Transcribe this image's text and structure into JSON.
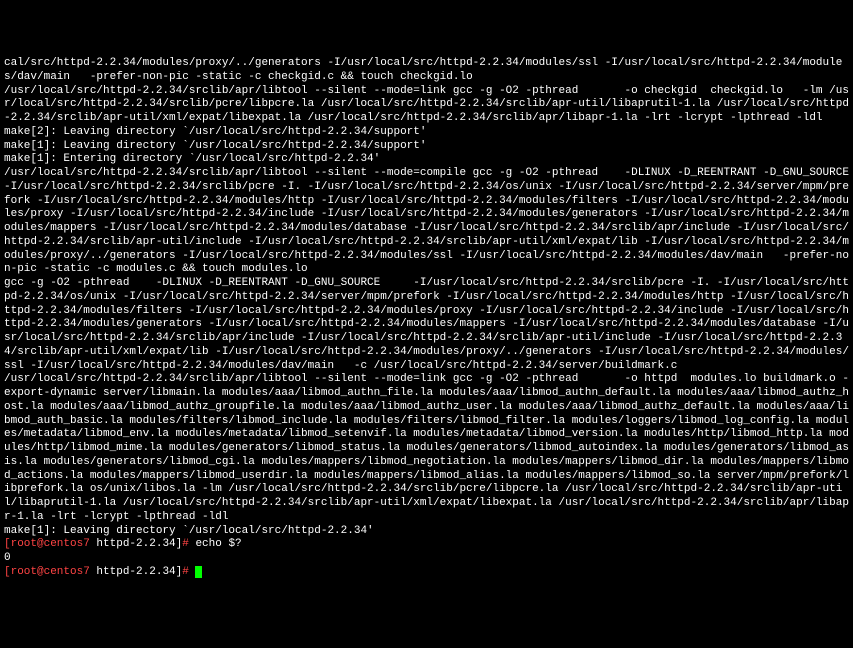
{
  "lines": [
    "cal/src/httpd-2.2.34/modules/proxy/../generators -I/usr/local/src/httpd-2.2.34/modules/ssl -I/usr/local/src/httpd-2.2.34/modules/dav/main   -prefer-non-pic -static -c checkgid.c && touch checkgid.lo",
    "/usr/local/src/httpd-2.2.34/srclib/apr/libtool --silent --mode=link gcc -g -O2 -pthread       -o checkgid  checkgid.lo   -lm /usr/local/src/httpd-2.2.34/srclib/pcre/libpcre.la /usr/local/src/httpd-2.2.34/srclib/apr-util/libaprutil-1.la /usr/local/src/httpd-2.2.34/srclib/apr-util/xml/expat/libexpat.la /usr/local/src/httpd-2.2.34/srclib/apr/libapr-1.la -lrt -lcrypt -lpthread -ldl",
    "make[2]: Leaving directory `/usr/local/src/httpd-2.2.34/support'",
    "make[1]: Leaving directory `/usr/local/src/httpd-2.2.34/support'",
    "make[1]: Entering directory `/usr/local/src/httpd-2.2.34'",
    "/usr/local/src/httpd-2.2.34/srclib/apr/libtool --silent --mode=compile gcc -g -O2 -pthread    -DLINUX -D_REENTRANT -D_GNU_SOURCE     -I/usr/local/src/httpd-2.2.34/srclib/pcre -I. -I/usr/local/src/httpd-2.2.34/os/unix -I/usr/local/src/httpd-2.2.34/server/mpm/prefork -I/usr/local/src/httpd-2.2.34/modules/http -I/usr/local/src/httpd-2.2.34/modules/filters -I/usr/local/src/httpd-2.2.34/modules/proxy -I/usr/local/src/httpd-2.2.34/include -I/usr/local/src/httpd-2.2.34/modules/generators -I/usr/local/src/httpd-2.2.34/modules/mappers -I/usr/local/src/httpd-2.2.34/modules/database -I/usr/local/src/httpd-2.2.34/srclib/apr/include -I/usr/local/src/httpd-2.2.34/srclib/apr-util/include -I/usr/local/src/httpd-2.2.34/srclib/apr-util/xml/expat/lib -I/usr/local/src/httpd-2.2.34/modules/proxy/../generators -I/usr/local/src/httpd-2.2.34/modules/ssl -I/usr/local/src/httpd-2.2.34/modules/dav/main   -prefer-non-pic -static -c modules.c && touch modules.lo",
    "gcc -g -O2 -pthread    -DLINUX -D_REENTRANT -D_GNU_SOURCE     -I/usr/local/src/httpd-2.2.34/srclib/pcre -I. -I/usr/local/src/httpd-2.2.34/os/unix -I/usr/local/src/httpd-2.2.34/server/mpm/prefork -I/usr/local/src/httpd-2.2.34/modules/http -I/usr/local/src/httpd-2.2.34/modules/filters -I/usr/local/src/httpd-2.2.34/modules/proxy -I/usr/local/src/httpd-2.2.34/include -I/usr/local/src/httpd-2.2.34/modules/generators -I/usr/local/src/httpd-2.2.34/modules/mappers -I/usr/local/src/httpd-2.2.34/modules/database -I/usr/local/src/httpd-2.2.34/srclib/apr/include -I/usr/local/src/httpd-2.2.34/srclib/apr-util/include -I/usr/local/src/httpd-2.2.34/srclib/apr-util/xml/expat/lib -I/usr/local/src/httpd-2.2.34/modules/proxy/../generators -I/usr/local/src/httpd-2.2.34/modules/ssl -I/usr/local/src/httpd-2.2.34/modules/dav/main   -c /usr/local/src/httpd-2.2.34/server/buildmark.c",
    "/usr/local/src/httpd-2.2.34/srclib/apr/libtool --silent --mode=link gcc -g -O2 -pthread       -o httpd  modules.lo buildmark.o -export-dynamic server/libmain.la modules/aaa/libmod_authn_file.la modules/aaa/libmod_authn_default.la modules/aaa/libmod_authz_host.la modules/aaa/libmod_authz_groupfile.la modules/aaa/libmod_authz_user.la modules/aaa/libmod_authz_default.la modules/aaa/libmod_auth_basic.la modules/filters/libmod_include.la modules/filters/libmod_filter.la modules/loggers/libmod_log_config.la modules/metadata/libmod_env.la modules/metadata/libmod_setenvif.la modules/metadata/libmod_version.la modules/http/libmod_http.la modules/http/libmod_mime.la modules/generators/libmod_status.la modules/generators/libmod_autoindex.la modules/generators/libmod_asis.la modules/generators/libmod_cgi.la modules/mappers/libmod_negotiation.la modules/mappers/libmod_dir.la modules/mappers/libmod_actions.la modules/mappers/libmod_userdir.la modules/mappers/libmod_alias.la modules/mappers/libmod_so.la server/mpm/prefork/libprefork.la os/unix/libos.la -lm /usr/local/src/httpd-2.2.34/srclib/pcre/libpcre.la /usr/local/src/httpd-2.2.34/srclib/apr-util/libaprutil-1.la /usr/local/src/httpd-2.2.34/srclib/apr-util/xml/expat/libexpat.la /usr/local/src/httpd-2.2.34/srclib/apr/libapr-1.la -lrt -lcrypt -lpthread -ldl",
    "make[1]: Leaving directory `/usr/local/src/httpd-2.2.34'"
  ],
  "prompt1": {
    "user": "[root@centos7",
    "path": " httpd-2.2.34]",
    "hash": "# ",
    "cmd": "echo $?"
  },
  "result": "0",
  "prompt2": {
    "user": "[root@centos7",
    "path": " httpd-2.2.34]",
    "hash": "# "
  }
}
